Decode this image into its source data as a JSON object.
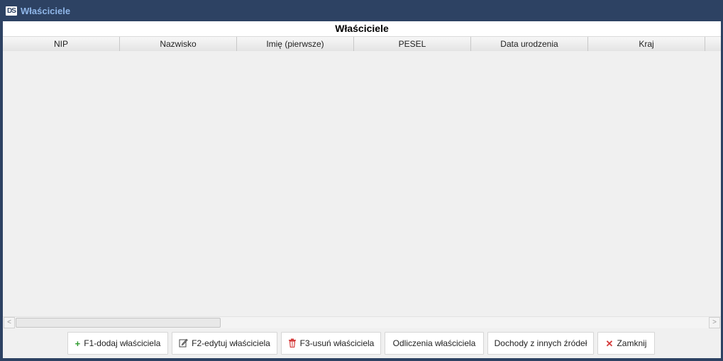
{
  "window": {
    "logo_text": "DS",
    "title": "Właściciele"
  },
  "table": {
    "caption": "Właściciele",
    "columns": [
      "NIP",
      "Nazwisko",
      "Imię (pierwsze)",
      "PESEL",
      "Data urodzenia",
      "Kraj"
    ],
    "rows": []
  },
  "scrollbar": {
    "left_arrow": "<",
    "right_arrow": ">"
  },
  "buttons": {
    "add": {
      "label": "F1-dodaj właściciela",
      "icon": "plus-icon"
    },
    "edit": {
      "label": "F2-edytuj właściciela",
      "icon": "edit-icon"
    },
    "delete": {
      "label": "F3-usuń właściciela",
      "icon": "trash-icon"
    },
    "deductions": {
      "label": "Odliczenia właściciela"
    },
    "other_income": {
      "label": "Dochody z innych źródeł"
    },
    "close": {
      "label": "Zamknij",
      "icon": "close-icon"
    }
  },
  "colors": {
    "titlebar_bg": "#2d4263",
    "title_text": "#8fb6e8",
    "content_bg": "#f0f0f0",
    "add_icon": "#2e9b2e",
    "delete_icon": "#d43b3b"
  }
}
